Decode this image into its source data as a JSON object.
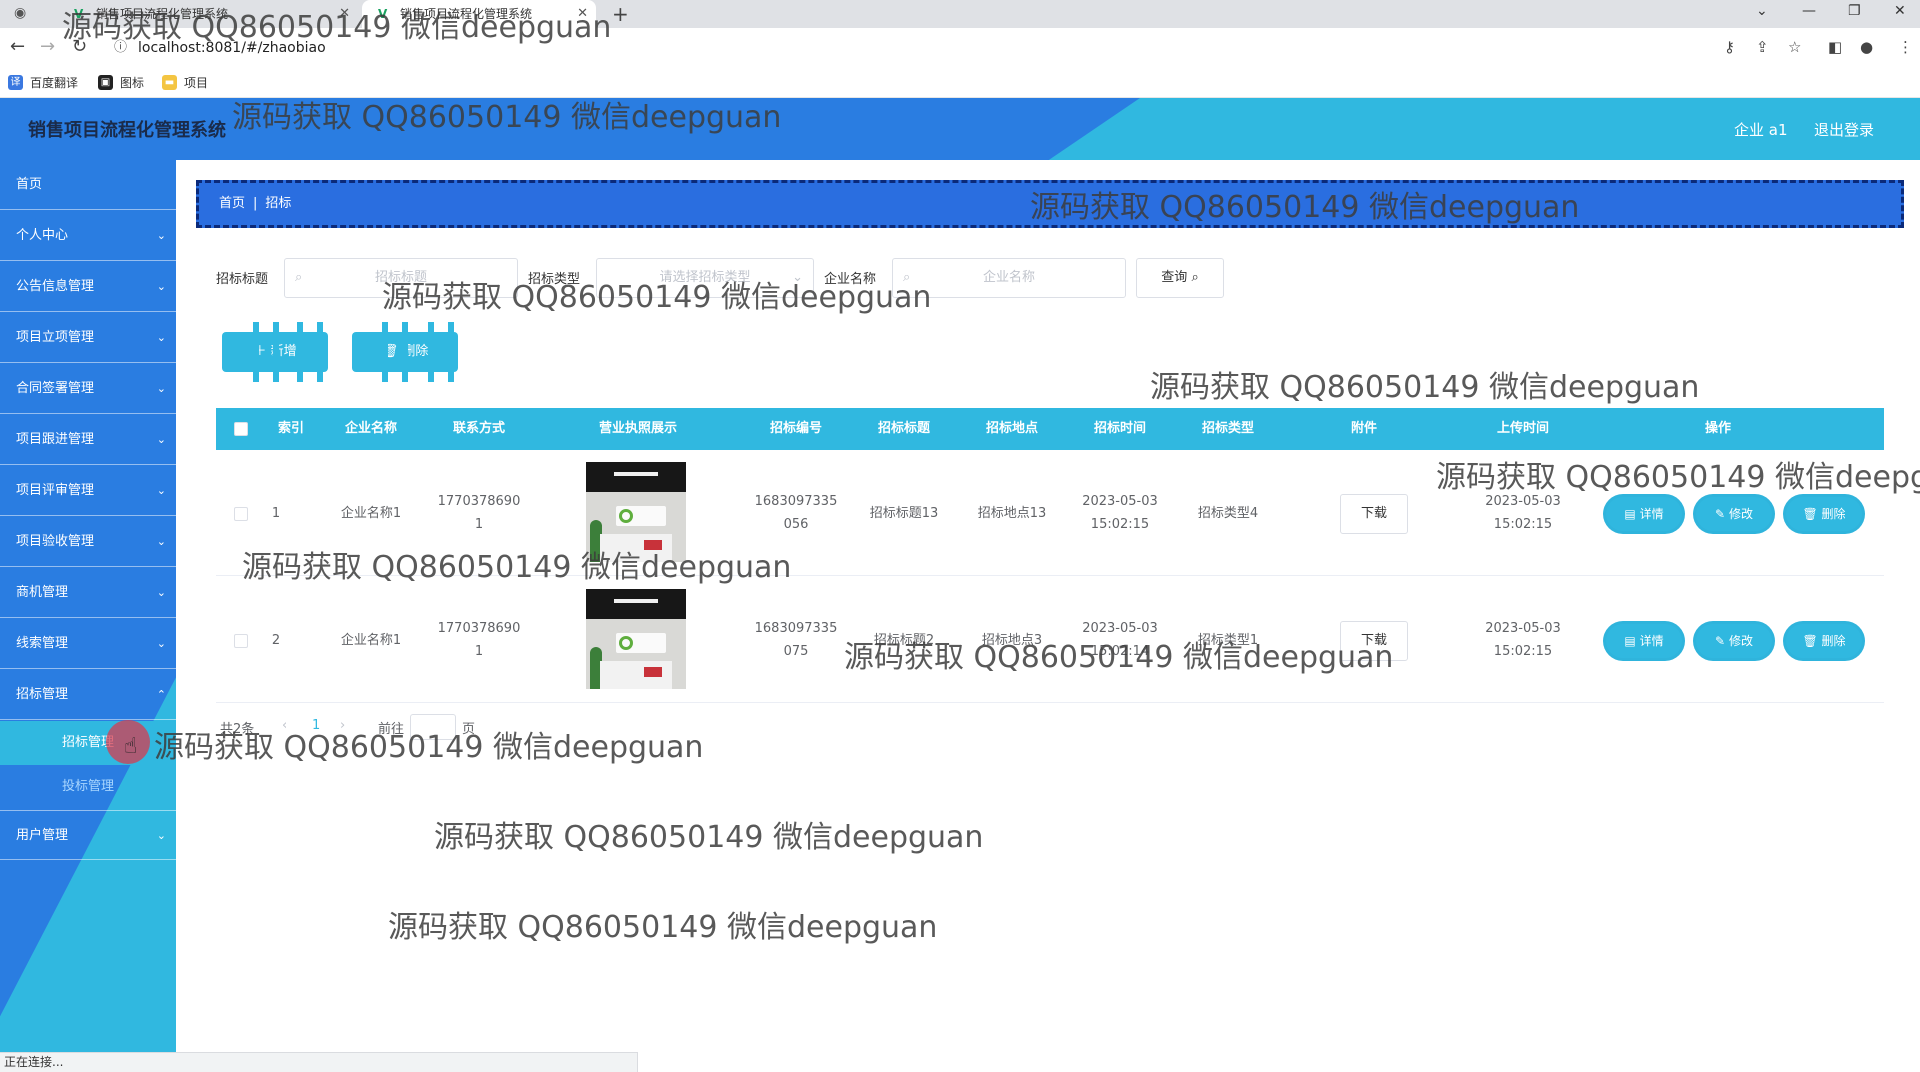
{
  "browser": {
    "tabs": [
      {
        "label": "销售项目流程化管理系统"
      },
      {
        "label": "销售项目流程化管理系统"
      }
    ],
    "url": "localhost:8081/#/zhaobiao",
    "bookmarks": [
      "百度翻译",
      "图标",
      "项目"
    ],
    "status": "正在连接..."
  },
  "header": {
    "title": "销售项目流程化管理系统",
    "user": "企业 a1",
    "logout": "退出登录"
  },
  "sidebar": {
    "items": [
      {
        "label": "首页"
      },
      {
        "label": "个人中心"
      },
      {
        "label": "公告信息管理"
      },
      {
        "label": "项目立项管理"
      },
      {
        "label": "合同签署管理"
      },
      {
        "label": "项目跟进管理"
      },
      {
        "label": "项目评审管理"
      },
      {
        "label": "项目验收管理"
      },
      {
        "label": "商机管理"
      },
      {
        "label": "线索管理"
      },
      {
        "label": "招标管理"
      }
    ],
    "sub_items": [
      {
        "label": "招标管理"
      },
      {
        "label": "投标管理"
      }
    ],
    "last_item": {
      "label": "用户管理"
    }
  },
  "breadcrumb": {
    "home": "首页",
    "sep": "|",
    "current": "招标"
  },
  "filters": {
    "title_label": "招标标题",
    "title_placeholder": "招标标题",
    "type_label": "招标类型",
    "type_placeholder": "请选择招标类型",
    "company_label": "企业名称",
    "company_placeholder": "企业名称",
    "query": "查询"
  },
  "actions": {
    "add": "新增",
    "delete": "删除"
  },
  "table": {
    "headers": [
      "索引",
      "企业名称",
      "联系方式",
      "营业执照展示",
      "招标编号",
      "招标标题",
      "招标地点",
      "招标时间",
      "招标类型",
      "附件",
      "上传时间",
      "操作"
    ],
    "rows": [
      {
        "index": "1",
        "company": "企业名称1",
        "contact": [
          "1770378690",
          "1"
        ],
        "number": [
          "1683097335",
          "056"
        ],
        "title": "招标标题13",
        "location": "招标地点13",
        "time": [
          "2023-05-03",
          "15:02:15"
        ],
        "type": "招标类型4",
        "attachment": "下载",
        "upload": [
          "2023-05-03",
          "15:02:15"
        ],
        "ops": [
          "详情",
          "修改",
          "删除"
        ]
      },
      {
        "index": "2",
        "company": "企业名称1",
        "contact": [
          "1770378690",
          "1"
        ],
        "number": [
          "1683097335",
          "075"
        ],
        "title": "招标标题2",
        "location": "招标地点3",
        "time": [
          "2023-05-03",
          "15:02:14"
        ],
        "type": "招标类型1",
        "attachment": "下载",
        "upload": [
          "2023-05-03",
          "15:02:15"
        ],
        "ops": [
          "详情",
          "修改",
          "删除"
        ]
      }
    ]
  },
  "pagination": {
    "total": "共2条",
    "page": "1",
    "goto": "前往",
    "page_unit": "页"
  },
  "watermark": "源码获取 QQ86050149 微信deepguan",
  "colors": {
    "blue": "#2a7de1",
    "cyan": "#30b8e0",
    "breadcrumb": "#2a6ee0"
  }
}
